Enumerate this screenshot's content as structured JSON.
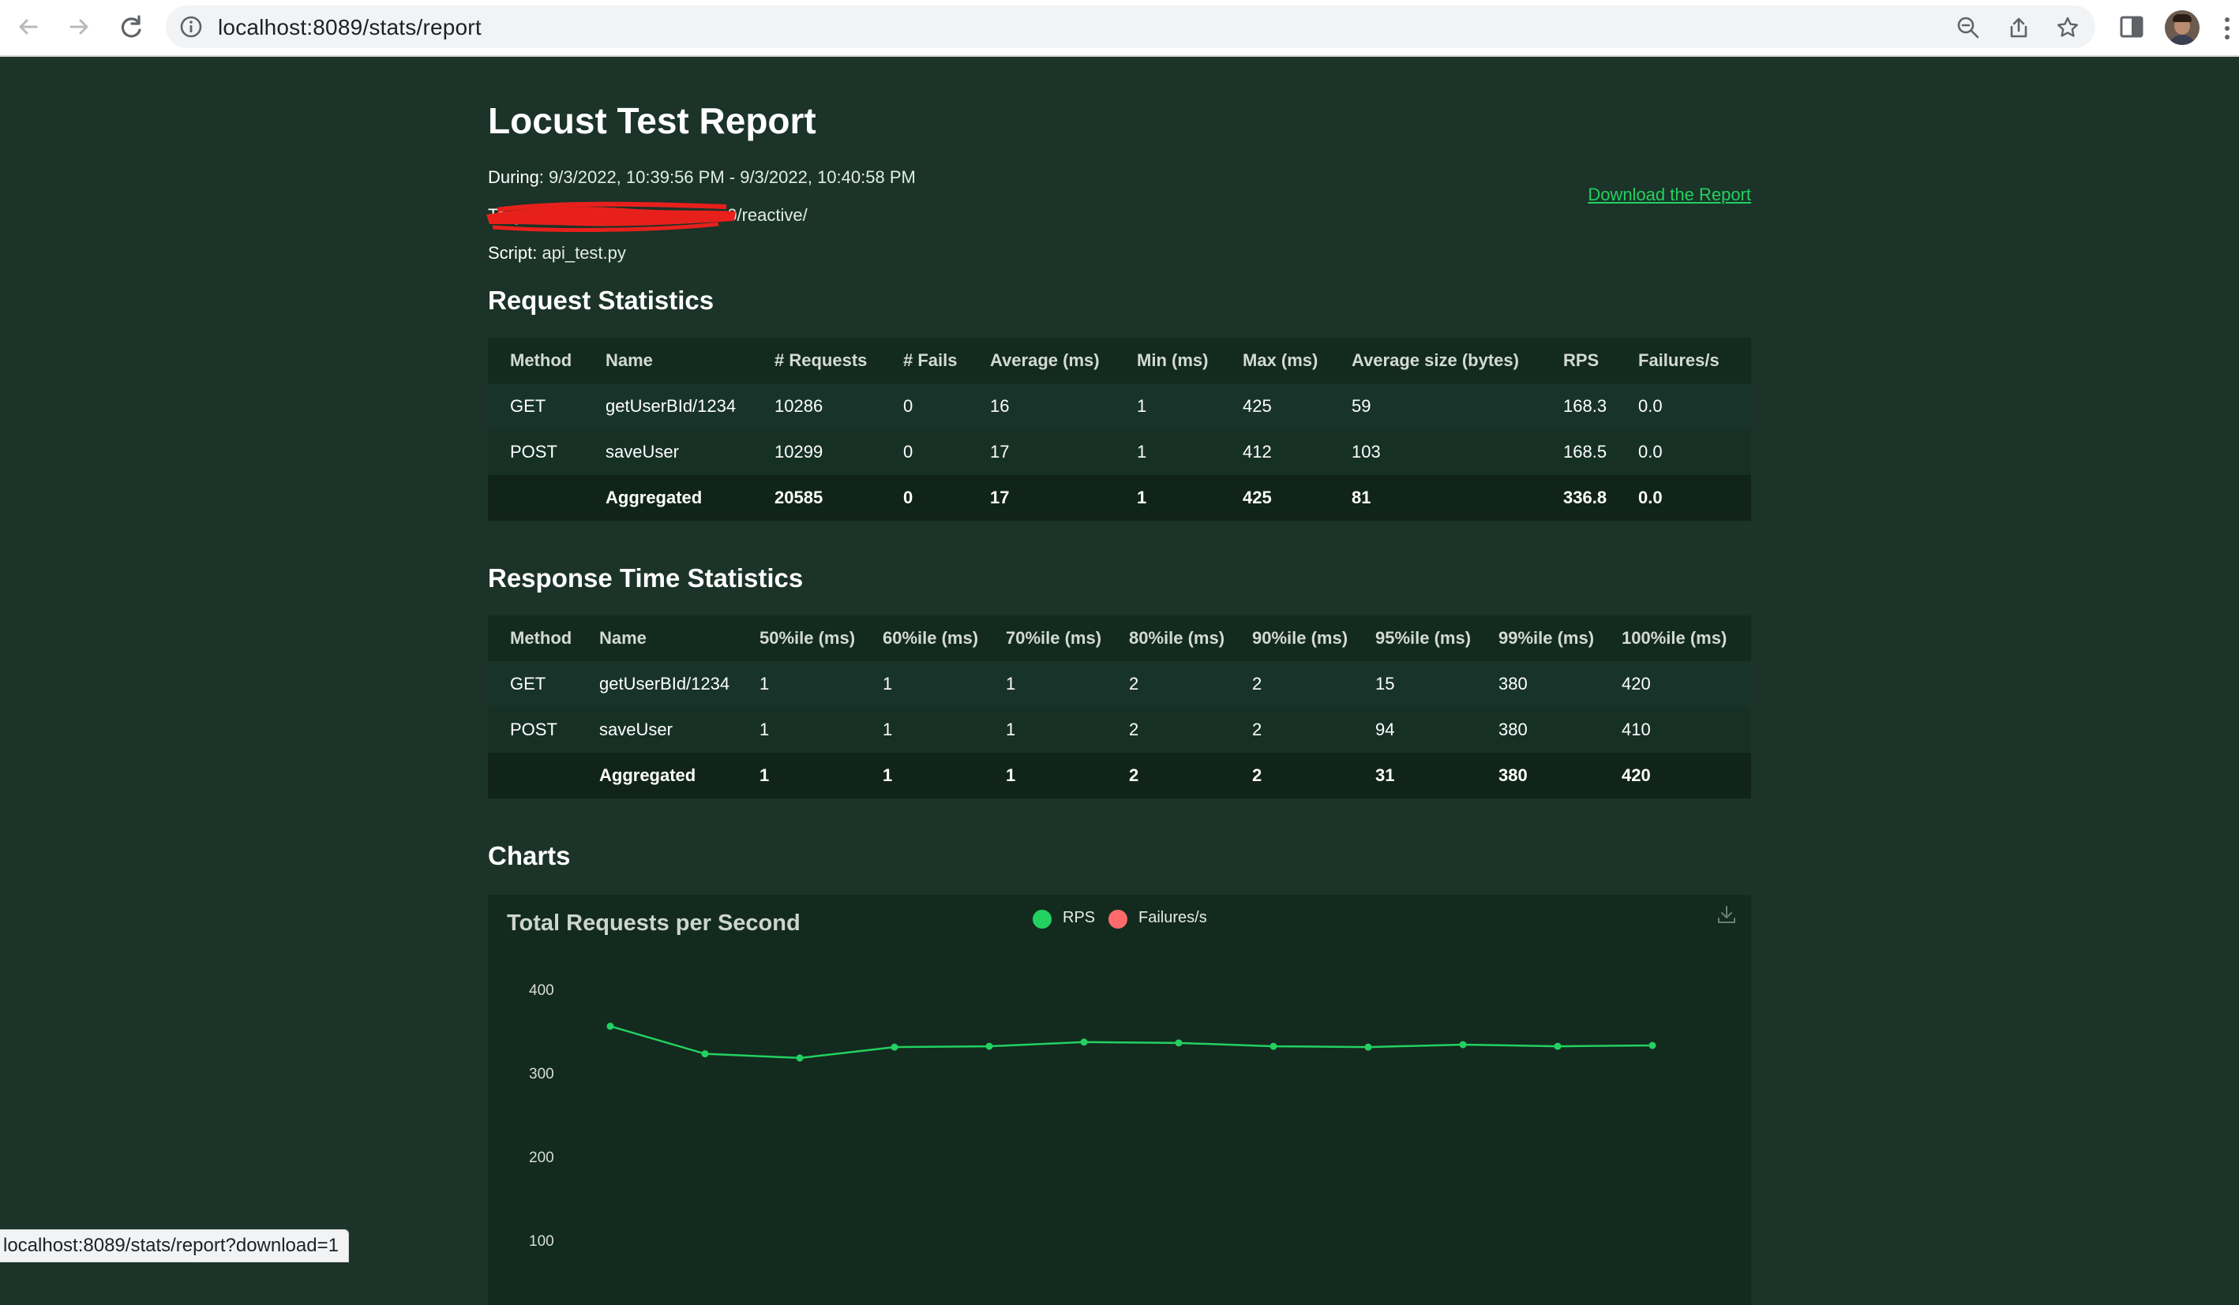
{
  "browser": {
    "url": "localhost:8089/stats/report",
    "status_url": "localhost:8089/stats/report?download=1"
  },
  "report": {
    "title": "Locust Test Report",
    "during_label": "During:",
    "during_value": "9/3/2022, 10:39:56 PM - 9/3/2022, 10:40:58 PM",
    "target_label": "Targ",
    "target_value": "...:0/reactive/",
    "script_label": "Script:",
    "script_value": "api_test.py",
    "download_link": "Download the Report"
  },
  "request_stats": {
    "heading": "Request Statistics",
    "columns": [
      "Method",
      "Name",
      "# Requests",
      "# Fails",
      "Average (ms)",
      "Min (ms)",
      "Max (ms)",
      "Average size (bytes)",
      "RPS",
      "Failures/s"
    ],
    "rows": [
      [
        "GET",
        "getUserBId/1234",
        "10286",
        "0",
        "16",
        "1",
        "425",
        "59",
        "168.3",
        "0.0"
      ],
      [
        "POST",
        "saveUser",
        "10299",
        "0",
        "17",
        "1",
        "412",
        "103",
        "168.5",
        "0.0"
      ],
      [
        "",
        "Aggregated",
        "20585",
        "0",
        "17",
        "1",
        "425",
        "81",
        "336.8",
        "0.0"
      ]
    ]
  },
  "response_stats": {
    "heading": "Response Time Statistics",
    "columns": [
      "Method",
      "Name",
      "50%ile (ms)",
      "60%ile (ms)",
      "70%ile (ms)",
      "80%ile (ms)",
      "90%ile (ms)",
      "95%ile (ms)",
      "99%ile (ms)",
      "100%ile (ms)"
    ],
    "rows": [
      [
        "GET",
        "getUserBId/1234",
        "1",
        "1",
        "1",
        "2",
        "2",
        "15",
        "380",
        "420"
      ],
      [
        "POST",
        "saveUser",
        "1",
        "1",
        "1",
        "2",
        "2",
        "94",
        "380",
        "410"
      ],
      [
        "",
        "Aggregated",
        "1",
        "1",
        "1",
        "2",
        "2",
        "31",
        "380",
        "420"
      ]
    ]
  },
  "charts": {
    "heading": "Charts"
  },
  "chart_data": {
    "type": "line",
    "title": "Total Requests per Second",
    "y_ticks": [
      "400",
      "300",
      "200",
      "100"
    ],
    "ylim": [
      0,
      400
    ],
    "series": [
      {
        "name": "RPS",
        "color": "#23d160",
        "values": [
          356,
          323,
          318,
          331,
          332,
          337,
          336,
          332,
          331,
          334,
          332,
          333
        ]
      },
      {
        "name": "Failures/s",
        "color": "#ff6b6b",
        "values": []
      }
    ]
  }
}
